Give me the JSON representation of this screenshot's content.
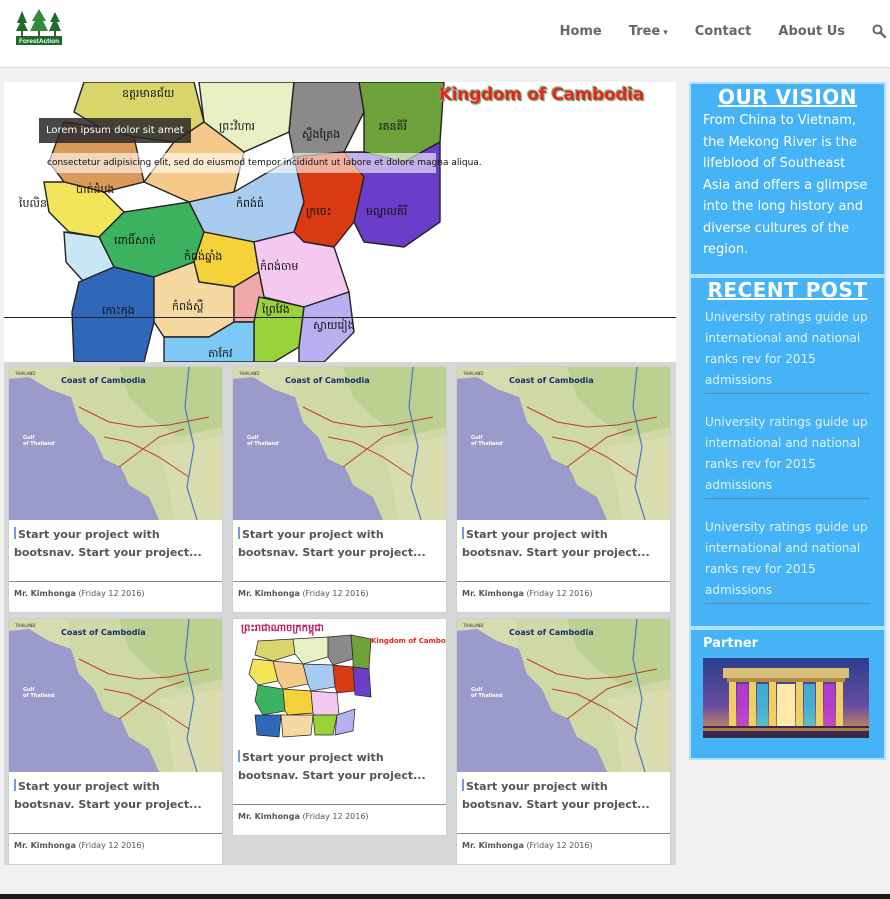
{
  "brand": {
    "logo_text": "ForestAction"
  },
  "nav": {
    "items": [
      {
        "label": "Home"
      },
      {
        "label": "Tree",
        "caret": "▾"
      },
      {
        "label": "Contact"
      },
      {
        "label": "About Us"
      }
    ]
  },
  "hero": {
    "map_title": "Kingdom of Cambodia",
    "caption_title": "Lorem ipsum dolor sit amet",
    "caption_text": "consectetur adipisicing elit, sed do eiusmod tempor incididunt ut labore et dolore magna aliqua."
  },
  "cards": [
    {
      "image": "coast-map",
      "title_line1": "Start your project with",
      "title_line2": "bootsnav. Start your project...",
      "author": "Mr. Kimhonga",
      "date": "(Friday 12 2016)"
    },
    {
      "image": "coast-map",
      "title_line1": "Start your project with",
      "title_line2": "bootsnav. Start your project...",
      "author": "Mr. Kimhonga",
      "date": "(Friday 12 2016)"
    },
    {
      "image": "coast-map",
      "title_line1": "Start your project with",
      "title_line2": "bootsnav. Start your project...",
      "author": "Mr. Kimhonga",
      "date": "(Friday 12 2016)"
    },
    {
      "image": "coast-map",
      "title_line1": "Start your project with",
      "title_line2": "bootsnav. Start your project...",
      "author": "Mr. Kimhonga",
      "date": "(Friday 12 2016)"
    },
    {
      "image": "province-map",
      "title_line1": "Start your project with",
      "title_line2": "bootsnav. Start your project...",
      "author": "Mr. Kimhonga",
      "date": "(Friday 12 2016)"
    },
    {
      "image": "coast-map",
      "title_line1": "Start your project with",
      "title_line2": "bootsnav. Start your project...",
      "author": "Mr. Kimhonga",
      "date": "(Friday 12 2016)"
    }
  ],
  "map_labels": {
    "coast_title": "Coast of Cambodia",
    "gulf": "Gulf of Thailand",
    "thailand": "THAILAND",
    "kingdom": "Kingdom of Cambodia"
  },
  "sidebar": {
    "vision_heading": "OUR VISION",
    "vision_text": "From China to Vietnam, the Mekong River is the lifeblood of Southeast Asia and offers a glimpse into the long history and diverse cultures of the region.",
    "recent_heading": "RECENT POST",
    "posts": [
      "University ratings guide up international and national ranks rev for 2015 admissions",
      "University ratings guide up international and national ranks rev for 2015 admissions",
      "University ratings guide up international and national ranks rev for 2015 admissions"
    ],
    "partner_heading": "Partner"
  },
  "colors": {
    "accent": "#45b3f5",
    "title_red": "#e3261b"
  },
  "icons": {
    "search": "search-icon",
    "caret": "caret-down-icon"
  }
}
